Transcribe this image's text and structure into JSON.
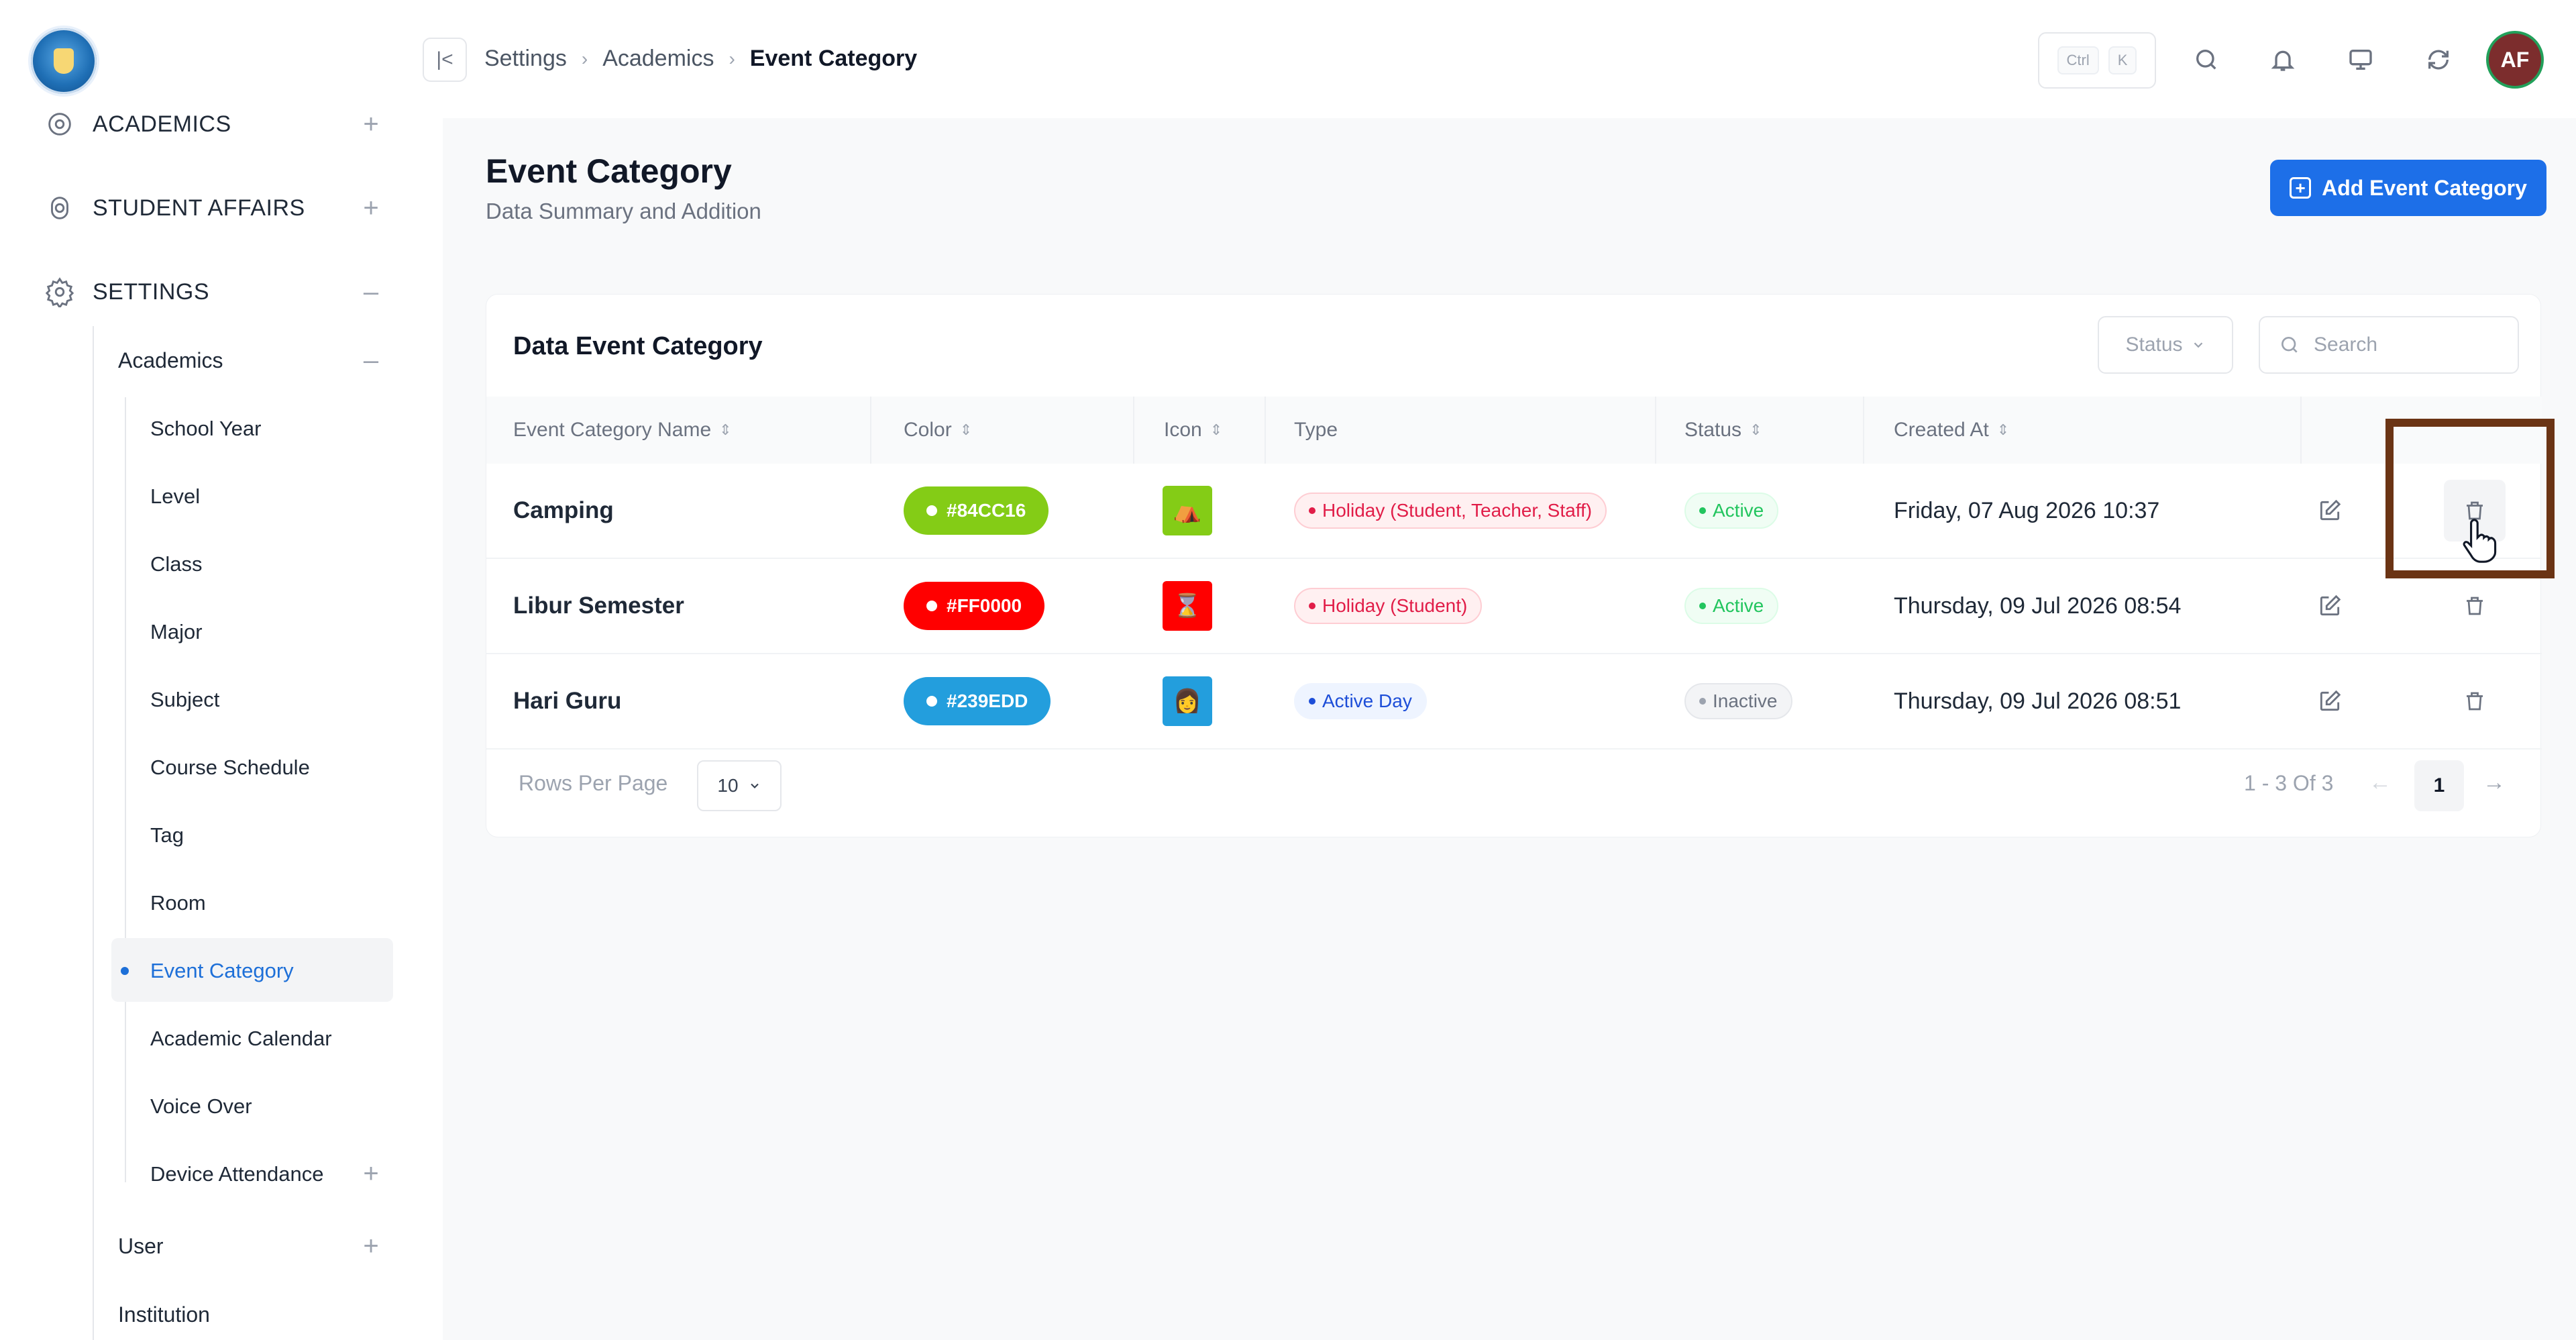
{
  "sidebar": {
    "top_items": [
      {
        "label": "ACADEMICS",
        "icon": "academics-icon",
        "toggle": "+"
      },
      {
        "label": "STUDENT AFFAIRS",
        "icon": "student-affairs-icon",
        "toggle": "+"
      },
      {
        "label": "SETTINGS",
        "icon": "gear-icon",
        "toggle": "–"
      }
    ],
    "sub_academics": {
      "label": "Academics",
      "toggle": "–"
    },
    "leaves": [
      {
        "label": "School Year"
      },
      {
        "label": "Level"
      },
      {
        "label": "Class"
      },
      {
        "label": "Major"
      },
      {
        "label": "Subject"
      },
      {
        "label": "Course Schedule"
      },
      {
        "label": "Tag"
      },
      {
        "label": "Room"
      },
      {
        "label": "Event Category",
        "active": true
      },
      {
        "label": "Academic Calendar"
      },
      {
        "label": "Voice Over"
      },
      {
        "label": "Device Attendance",
        "toggle": "+"
      }
    ],
    "user": {
      "label": "User",
      "toggle": "+"
    },
    "institution": {
      "label": "Institution"
    }
  },
  "topbar": {
    "breadcrumb": [
      "Settings",
      "Academics",
      "Event Category"
    ],
    "shortcut_keys": [
      "Ctrl",
      "K"
    ],
    "avatar_initials": "AF"
  },
  "page": {
    "title": "Event Category",
    "subtitle": "Data Summary and Addition",
    "add_button_label": "Add Event Category"
  },
  "table_card": {
    "title": "Data Event Category",
    "status_filter_label": "Status",
    "search_placeholder": "Search",
    "columns": [
      "Event Category Name",
      "Color",
      "Icon",
      "Type",
      "Status",
      "Created At"
    ],
    "rows": [
      {
        "name": "Camping",
        "color_hex": "#84CC16",
        "icon_bg": "#84CC16",
        "icon_glyph": "⛺",
        "type": "Holiday (Student, Teacher, Staff)",
        "type_style": "red",
        "status": "Active",
        "created_at": "Friday, 07 Aug 2026 10:37"
      },
      {
        "name": "Libur Semester",
        "color_hex": "#FF0000",
        "icon_bg": "#FF0000",
        "icon_glyph": "⌛",
        "type": "Holiday (Student)",
        "type_style": "red",
        "status": "Active",
        "created_at": "Thursday, 09 Jul 2026 08:54"
      },
      {
        "name": "Hari Guru",
        "color_hex": "#239EDD",
        "icon_bg": "#239EDD",
        "icon_glyph": "👩",
        "type": "Active Day",
        "type_style": "blue",
        "status": "Inactive",
        "created_at": "Thursday, 09 Jul 2026 08:51"
      }
    ],
    "pagination": {
      "rows_per_page_label": "Rows Per Page",
      "rows_per_page_value": "10",
      "range_text": "1 - 3 Of 3",
      "current_page": "1"
    }
  },
  "colors": {
    "primary": "#1D6FE8",
    "active_nav": "#1D6FD8",
    "highlight_box": "#6B3414"
  }
}
